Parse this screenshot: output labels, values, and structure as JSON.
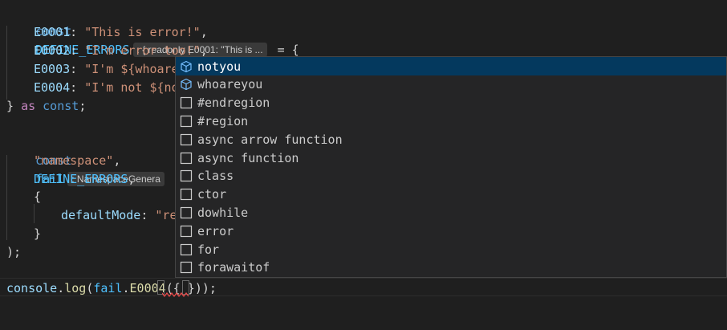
{
  "colors": {
    "background": "#1f1f1f",
    "keyword": "#569cd6",
    "keyword_control": "#c586c0",
    "const_var": "#4fc1ff",
    "property": "#9cdcfe",
    "string": "#ce9178",
    "function": "#dcdcaa",
    "suggest_bg": "#252526",
    "suggest_selected_bg": "#04395e",
    "error_squiggle": "#f14c4c"
  },
  "code": {
    "l1": {
      "kw": "const",
      "name": "DEFINE_ERRORS",
      "hint": ": { readonly E0001: \"This is ...",
      "tail": " = {"
    },
    "l2": {
      "key": "E0001",
      "sep": ": ",
      "str": "\"This is error!\"",
      "tail": ","
    },
    "l3": {
      "key": "E0002",
      "sep": ": ",
      "str": "\"I'm error too!\"",
      "tail": ","
    },
    "l4": {
      "key": "E0003",
      "sep": ": ",
      "str": "\"I'm ${whoarey"
    },
    "l5": {
      "key": "E0004",
      "sep": ": ",
      "str": "\"I'm not ${not"
    },
    "l6": {
      "a": "} ",
      "as": "as",
      "sp": " ",
      "const": "const",
      "semi": ";"
    },
    "l8": {
      "kw": "const",
      "name": "fail",
      "hint": ": NamespaceGenera"
    },
    "l9": {
      "str": "\"namespace\"",
      "tail": ","
    },
    "l10": {
      "name": "DEFINE_ERRORS",
      "tail": ","
    },
    "l11": {
      "text": "{"
    },
    "l12": {
      "key": "defaultMode",
      "sep": ": ",
      "str": "\"rel"
    },
    "l13": {
      "text": "}"
    },
    "l14": {
      "text": ");"
    },
    "l16": {
      "obj": "console",
      "dot1": ".",
      "fn": "log",
      "p1": "(",
      "var": "fail",
      "dot2": ".",
      "fn2": "E0004",
      "p2": "(",
      "b1": "{",
      "sp": " ",
      "b2": "}",
      "end": "));"
    }
  },
  "suggest": {
    "items": [
      {
        "label": "notyou",
        "icon": "property-cube-icon",
        "selected": true
      },
      {
        "label": "whoareyou",
        "icon": "property-cube-icon",
        "selected": false
      },
      {
        "label": "#endregion",
        "icon": "snippet-square-icon",
        "selected": false
      },
      {
        "label": "#region",
        "icon": "snippet-square-icon",
        "selected": false
      },
      {
        "label": "async arrow function",
        "icon": "snippet-square-icon",
        "selected": false
      },
      {
        "label": "async function",
        "icon": "snippet-square-icon",
        "selected": false
      },
      {
        "label": "class",
        "icon": "snippet-square-icon",
        "selected": false
      },
      {
        "label": "ctor",
        "icon": "snippet-square-icon",
        "selected": false
      },
      {
        "label": "dowhile",
        "icon": "snippet-square-icon",
        "selected": false
      },
      {
        "label": "error",
        "icon": "snippet-square-icon",
        "selected": false
      },
      {
        "label": "for",
        "icon": "snippet-square-icon",
        "selected": false
      },
      {
        "label": "forawaitof",
        "icon": "snippet-square-icon",
        "selected": false
      }
    ]
  }
}
